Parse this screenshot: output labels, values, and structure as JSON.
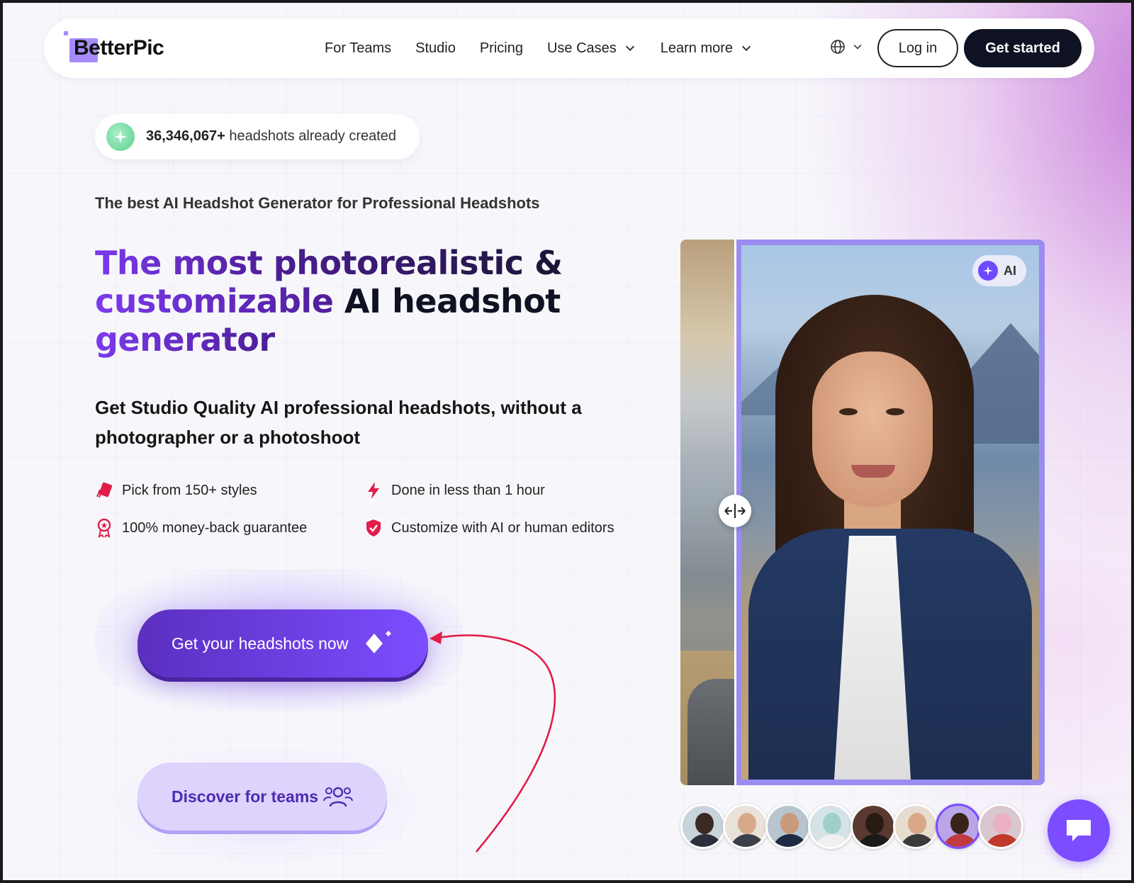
{
  "nav": {
    "logo": "BetterPic",
    "links": [
      {
        "label": "For Teams",
        "dropdown": false
      },
      {
        "label": "Studio",
        "dropdown": false
      },
      {
        "label": "Pricing",
        "dropdown": false
      },
      {
        "label": "Use Cases",
        "dropdown": true
      },
      {
        "label": "Learn more",
        "dropdown": true
      }
    ],
    "login": "Log in",
    "get_started": "Get started"
  },
  "badge": {
    "count": "36,346,067+",
    "text": " headshots already created"
  },
  "hero": {
    "subheading": "The best AI Headshot Generator for Professional Headshots",
    "headline_1": "The most ",
    "headline_2": "photorealistic &",
    "headline_3": "customizable ",
    "headline_4": "AI headshot",
    "headline_5": "generator",
    "lead": "Get Studio Quality AI professional headshots, without a photographer or a photoshoot"
  },
  "features": [
    {
      "label": "Pick from 150+ styles",
      "icon": "styles-tag-icon"
    },
    {
      "label": "Done in less than 1 hour",
      "icon": "lightning-icon"
    },
    {
      "label": "100% money-back guarantee",
      "icon": "award-ribbon-icon"
    },
    {
      "label": "Customize with AI or human editors",
      "icon": "shield-check-icon"
    }
  ],
  "cta": {
    "primary": "Get your headshots now",
    "secondary": "Discover for teams"
  },
  "compare": {
    "ai_label": "AI"
  },
  "avatars_count": 8,
  "colors": {
    "primary": "#7c4dff",
    "dark": "#0f1222",
    "accent_red": "#e11d48",
    "badge_green": "#5ad08e"
  }
}
